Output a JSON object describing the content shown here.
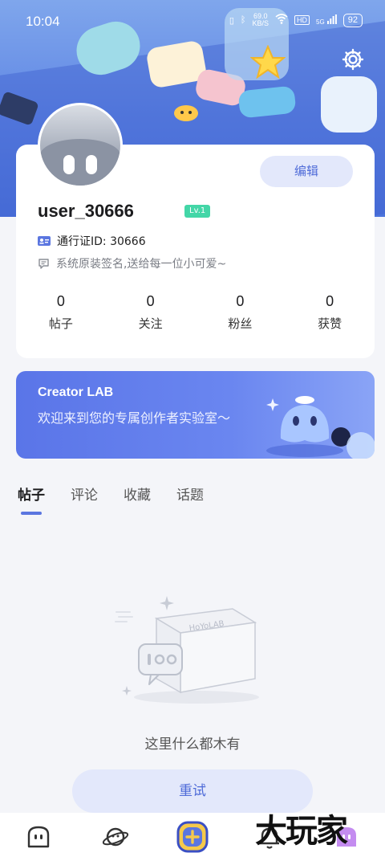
{
  "status_bar": {
    "time": "10:04",
    "net_speed": "69.0",
    "net_unit": "KB/S",
    "battery": "92",
    "hd": "HD",
    "signal": "5G"
  },
  "profile": {
    "edit_label": "编辑",
    "username": "user_30666",
    "level": "Lv.1",
    "pass_id": "通行证ID: 30666",
    "signature": "系统原装签名,送给每一位小可爱~"
  },
  "stats": [
    {
      "value": "0",
      "label": "帖子"
    },
    {
      "value": "0",
      "label": "关注"
    },
    {
      "value": "0",
      "label": "粉丝"
    },
    {
      "value": "0",
      "label": "获赞"
    }
  ],
  "banner": {
    "title": "Creator LAB",
    "description": "欢迎来到您的专属创作者实验室～"
  },
  "tabs": [
    {
      "label": "帖子",
      "active": true
    },
    {
      "label": "评论",
      "active": false
    },
    {
      "label": "收藏",
      "active": false
    },
    {
      "label": "话题",
      "active": false
    }
  ],
  "empty_state": {
    "box_label": "HoYoLAB",
    "message": "这里什么都木有",
    "retry_label": "重试"
  },
  "watermark": "大玩家",
  "colors": {
    "accent": "#5b76e0",
    "level_badge": "#43d6a7",
    "button_bg": "#e3e8fb"
  },
  "nav_icons": [
    "home-icon",
    "planet-icon",
    "create-icon",
    "bell-icon",
    "profile-icon"
  ]
}
